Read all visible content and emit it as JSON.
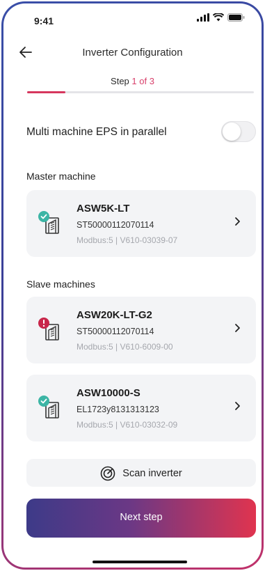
{
  "status_bar": {
    "time": "9:41"
  },
  "header": {
    "title": "Inverter Configuration"
  },
  "stepper": {
    "prefix": "Step",
    "current": "1 of 3",
    "progress": 0.17
  },
  "eps": {
    "label": "Multi machine EPS in parallel",
    "enabled": false
  },
  "master": {
    "heading": "Master  machine",
    "card": {
      "model": "ASW5K-LT",
      "serial": "ST50000112070114",
      "meta": "Modbus:5 | V610-03039-07",
      "status": "ok"
    }
  },
  "slaves": {
    "heading": "Slave machines",
    "cards": [
      {
        "model": "ASW20K-LT-G2",
        "serial": "ST50000112070114",
        "meta": "Modbus:5 | V610-6009-00",
        "status": "error"
      },
      {
        "model": "ASW10000-S",
        "serial": "EL1723y8131313123",
        "meta": "Modbus:5 | V610-03032-09",
        "status": "ok"
      }
    ]
  },
  "actions": {
    "scan_label": "Scan inverter",
    "next_label": "Next step"
  },
  "colors": {
    "accent": "#d6365d",
    "ok": "#3cb5a5",
    "error": "#c8264a"
  }
}
